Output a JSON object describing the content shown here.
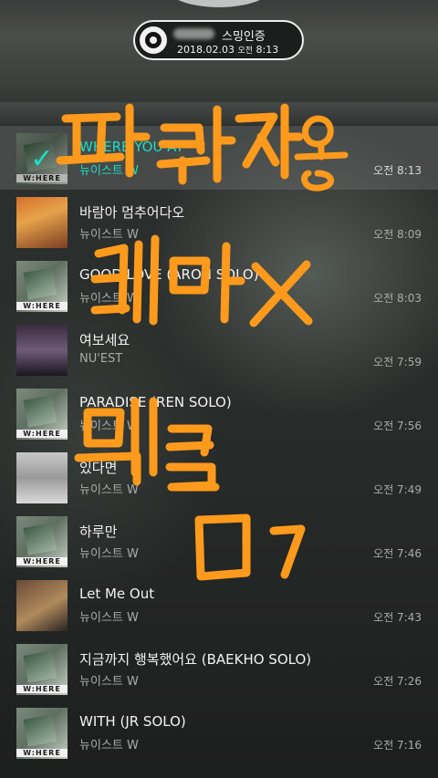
{
  "auth": {
    "label": "스밍인증",
    "date": "2018.02.03",
    "ampm": "오전",
    "time": "8:13"
  },
  "songs": [
    {
      "title": "WHERE YOU AT",
      "artist": "뉴이스트 W",
      "time": "오전 8:13"
    },
    {
      "title": "바람아 멈추어다오",
      "artist": "뉴이스트 W",
      "time": "오전 8:09"
    },
    {
      "title": "GOOD LOVE (ARON SOLO)",
      "artist": "뉴이스트 W",
      "time": "오전 8:03"
    },
    {
      "title": "여보세요",
      "artist": "NU'EST",
      "time": "오전 7:59"
    },
    {
      "title": "PARADISE (REN SOLO)",
      "artist": "뉴이스트 W",
      "time": "오전 7:56"
    },
    {
      "title": "있다면",
      "artist": "뉴이스트 W",
      "time": "오전 7:49"
    },
    {
      "title": "하루만",
      "artist": "뉴이스트 W",
      "time": "오전 7:46"
    },
    {
      "title": "Let Me Out",
      "artist": "뉴이스트 W",
      "time": "오전 7:43"
    },
    {
      "title": "지금까지 행복했어요 (BAEKHO SOLO)",
      "artist": "뉴이스트 W",
      "time": "오전 7:26"
    },
    {
      "title": "WITH (JR SOLO)",
      "artist": "뉴이스트 W",
      "time": "오전 7:16"
    }
  ],
  "colors": {
    "accent": "#19e0c4",
    "handwriting": "#ff9a1c"
  },
  "icons": [
    "disc-icon",
    "checkmark-icon"
  ]
}
